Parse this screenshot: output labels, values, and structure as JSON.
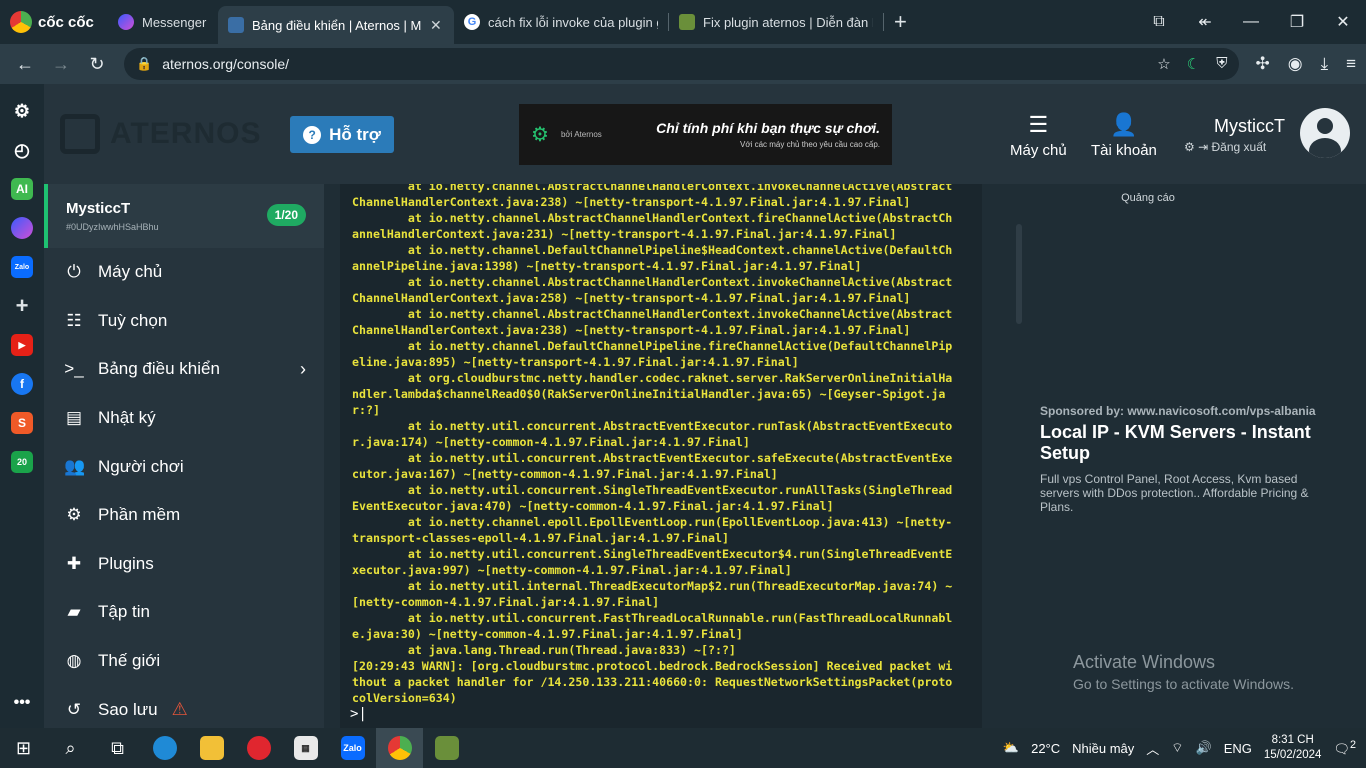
{
  "browser": {
    "brand": "cốc cốc",
    "tabs": [
      {
        "title": "Messenger",
        "active": false
      },
      {
        "title": "Bảng điều khiển | Aternos | M",
        "active": true
      },
      {
        "title": "cách fix lỗi invoke của plugin geys",
        "active": false
      },
      {
        "title": "Fix plugin aternos | Diễn đàn Mine",
        "active": false
      }
    ],
    "url": "aternos.org/console/"
  },
  "header": {
    "logo_text": "ATERNOS",
    "help_label": "Hỗ trợ",
    "banner": {
      "by": "bởi Aternos",
      "headline": "Chỉ tính phí khi bạn thực sự chơi.",
      "sub": "Với các máy chủ theo yêu cầu cao cấp."
    },
    "servers_label": "Máy chủ",
    "account_label": "Tài khoản",
    "username": "MysticcT",
    "logout_label": "Đăng xuất"
  },
  "server": {
    "name": "MysticcT",
    "id": "#0UDyzIwwhHSaHBhu",
    "count": "1/20"
  },
  "menu": [
    {
      "label": "Máy chủ",
      "icon": "power-icon"
    },
    {
      "label": "Tuỳ chọn",
      "icon": "sliders-icon"
    },
    {
      "label": "Bảng điều khiển",
      "icon": "terminal-icon"
    },
    {
      "label": "Nhật ký",
      "icon": "file-icon"
    },
    {
      "label": "Người chơi",
      "icon": "users-icon"
    },
    {
      "label": "Phần mềm",
      "icon": "gears-icon"
    },
    {
      "label": "Plugins",
      "icon": "puzzle-icon"
    },
    {
      "label": "Tập tin",
      "icon": "folder-icon"
    },
    {
      "label": "Thế giới",
      "icon": "globe-icon"
    },
    {
      "label": "Sao lưu",
      "icon": "history-icon"
    }
  ],
  "console": {
    "log": "        at io.netty.channel.AbstractChannelHandlerContext.invokeChannelActive(Abstract\nChannelHandlerContext.java:238) ~[netty-transport-4.1.97.Final.jar:4.1.97.Final]\n        at io.netty.channel.AbstractChannelHandlerContext.fireChannelActive(AbstractCh\nannelHandlerContext.java:231) ~[netty-transport-4.1.97.Final.jar:4.1.97.Final]\n        at io.netty.channel.DefaultChannelPipeline$HeadContext.channelActive(DefaultCh\nannelPipeline.java:1398) ~[netty-transport-4.1.97.Final.jar:4.1.97.Final]\n        at io.netty.channel.AbstractChannelHandlerContext.invokeChannelActive(Abstract\nChannelHandlerContext.java:258) ~[netty-transport-4.1.97.Final.jar:4.1.97.Final]\n        at io.netty.channel.AbstractChannelHandlerContext.invokeChannelActive(Abstract\nChannelHandlerContext.java:238) ~[netty-transport-4.1.97.Final.jar:4.1.97.Final]\n        at io.netty.channel.DefaultChannelPipeline.fireChannelActive(DefaultChannelPip\neline.java:895) ~[netty-transport-4.1.97.Final.jar:4.1.97.Final]\n        at org.cloudburstmc.netty.handler.codec.raknet.server.RakServerOnlineInitialHa\nndler.lambda$channelRead0$0(RakServerOnlineInitialHandler.java:65) ~[Geyser-Spigot.ja\nr:?]\n        at io.netty.util.concurrent.AbstractEventExecutor.runTask(AbstractEventExecuto\nr.java:174) ~[netty-common-4.1.97.Final.jar:4.1.97.Final]\n        at io.netty.util.concurrent.AbstractEventExecutor.safeExecute(AbstractEventExe\ncutor.java:167) ~[netty-common-4.1.97.Final.jar:4.1.97.Final]\n        at io.netty.util.concurrent.SingleThreadEventExecutor.runAllTasks(SingleThread\nEventExecutor.java:470) ~[netty-common-4.1.97.Final.jar:4.1.97.Final]\n        at io.netty.channel.epoll.EpollEventLoop.run(EpollEventLoop.java:413) ~[netty-\ntransport-classes-epoll-4.1.97.Final.jar:4.1.97.Final]\n        at io.netty.util.concurrent.SingleThreadEventExecutor$4.run(SingleThreadEventE\nxecutor.java:997) ~[netty-common-4.1.97.Final.jar:4.1.97.Final]\n        at io.netty.util.internal.ThreadExecutorMap$2.run(ThreadExecutorMap.java:74) ~\n[netty-common-4.1.97.Final.jar:4.1.97.Final]\n        at io.netty.util.concurrent.FastThreadLocalRunnable.run(FastThreadLocalRunnabl\ne.java:30) ~[netty-common-4.1.97.Final.jar:4.1.97.Final]\n        at java.lang.Thread.run(Thread.java:833) ~[?:?]\n[20:29:43 WARN]: [org.cloudburstmc.protocol.bedrock.BedrockSession] Received packet wi\nthout a packet handler for /14.250.133.211:40660:0: RequestNetworkSettingsPacket(proto\ncolVersion=634)",
    "prompt": ">|"
  },
  "ad": {
    "label": "Quảng cáo",
    "sponsor": "Sponsored by: www.navicosoft.com/vps-albania",
    "headline": "Local IP - KVM Servers - Instant Setup",
    "body": "Full vps Control Panel, Root Access, Kvm based servers with DDos protection.. Affordable Pricing & Plans."
  },
  "windows_watermark": {
    "title": "Activate Windows",
    "sub": "Go to Settings to activate Windows."
  },
  "taskbar": {
    "weather": "22°C",
    "weather_text": "Nhiều mây",
    "lang": "ENG",
    "time": "8:31 CH",
    "date": "15/02/2024",
    "notif_count": "2"
  },
  "colors": {
    "accent_green": "#1fc272",
    "help_blue": "#2b7bb9",
    "log_yellow": "#e8e23c"
  }
}
